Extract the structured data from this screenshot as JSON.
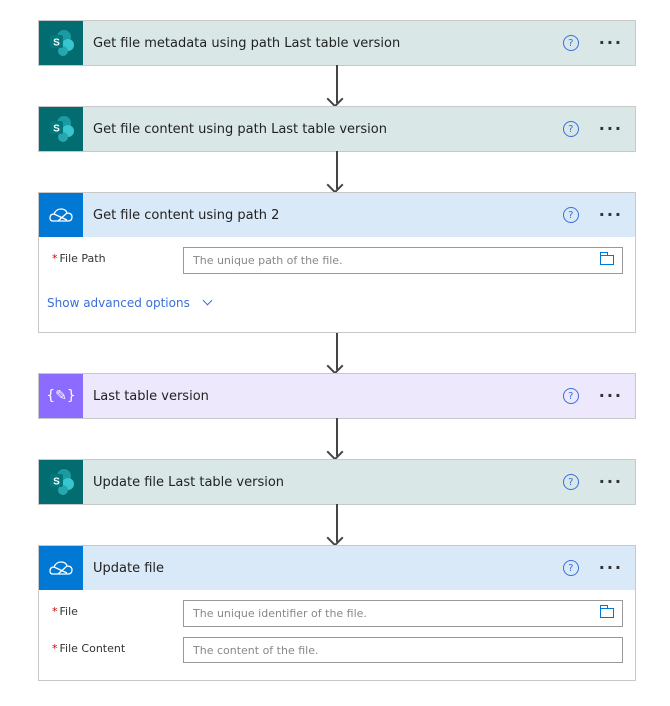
{
  "steps": [
    {
      "title": "Get file metadata using path Last table version",
      "type": "sharepoint",
      "icon": "sharepoint-icon"
    },
    {
      "title": "Get file content using path Last table version",
      "type": "sharepoint",
      "icon": "sharepoint-icon"
    },
    {
      "title": "Get file content using path 2",
      "type": "onedrive",
      "icon": "onedrive-cloud-icon",
      "fields": [
        {
          "label": "File Path",
          "required": "*",
          "placeholder": "The unique path of the file."
        }
      ],
      "advanced": "Show advanced options"
    },
    {
      "title": "Last table version",
      "type": "variable",
      "icon": "variable-icon"
    },
    {
      "title": "Update file Last table version",
      "type": "sharepoint",
      "icon": "sharepoint-icon"
    },
    {
      "title": "Update file",
      "type": "onedrive",
      "icon": "onedrive-cloud-icon",
      "fields": [
        {
          "label": "File",
          "required": "*",
          "placeholder": "The unique identifier of the file."
        },
        {
          "label": "File Content",
          "required": "*",
          "placeholder": "The content of the file."
        }
      ]
    }
  ],
  "help": "?",
  "more": "···",
  "colors": {
    "sharepoint": "#036c70",
    "onedrive": "#0078d4",
    "variable": "#8c6cff",
    "link": "#3a6fd8"
  }
}
